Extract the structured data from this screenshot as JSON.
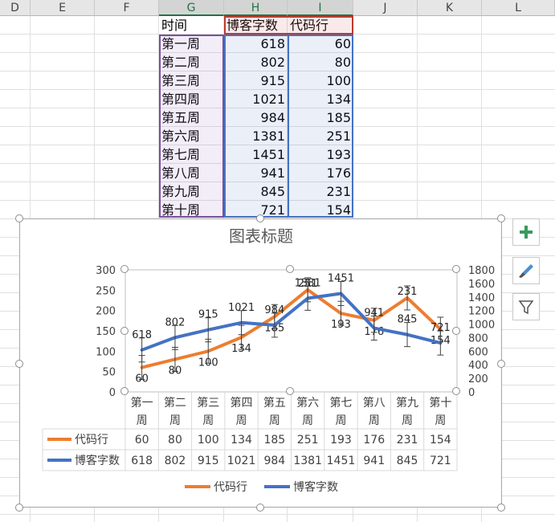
{
  "sheet": {
    "columns": [
      "D",
      "E",
      "F",
      "G",
      "H",
      "I",
      "J",
      "K",
      "L"
    ],
    "table_header": [
      "时间",
      "博客字数",
      "代码行"
    ],
    "rows": [
      [
        "第一周",
        "618",
        "60"
      ],
      [
        "第二周",
        "802",
        "80"
      ],
      [
        "第三周",
        "915",
        "100"
      ],
      [
        "第四周",
        "1021",
        "134"
      ],
      [
        "第五周",
        "984",
        "185"
      ],
      [
        "第六周",
        "1381",
        "251"
      ],
      [
        "第七周",
        "1451",
        "193"
      ],
      [
        "第八周",
        "941",
        "176"
      ],
      [
        "第九周",
        "845",
        "231"
      ],
      [
        "第十周",
        "721",
        "154"
      ]
    ]
  },
  "chart_data": {
    "type": "line",
    "title": "图表标题",
    "categories": [
      "第一周",
      "第二周",
      "第三周",
      "第四周",
      "第五周",
      "第六周",
      "第七周",
      "第八周",
      "第九周",
      "第十周"
    ],
    "series": [
      {
        "name": "代码行",
        "axis": "left",
        "color": "#ED7D31",
        "values": [
          60,
          80,
          100,
          134,
          185,
          251,
          193,
          176,
          231,
          154
        ]
      },
      {
        "name": "博客字数",
        "axis": "right",
        "color": "#4472C4",
        "values": [
          618,
          802,
          915,
          1021,
          984,
          1381,
          1451,
          941,
          845,
          721
        ]
      }
    ],
    "y_left": {
      "min": 0,
      "max": 300,
      "ticks": [
        0,
        50,
        100,
        150,
        200,
        250,
        300
      ]
    },
    "y_right": {
      "min": 0,
      "max": 1800,
      "ticks": [
        0,
        200,
        400,
        600,
        800,
        1000,
        1200,
        1400,
        1600,
        1800
      ]
    },
    "error_bars": true,
    "data_table": true,
    "legend_position": "bottom"
  },
  "colors": {
    "accent_green": "#217346",
    "orange": "#ED7D31",
    "blue": "#4472C4"
  },
  "side_buttons": [
    "plus-icon",
    "brush-icon",
    "filter-icon"
  ]
}
